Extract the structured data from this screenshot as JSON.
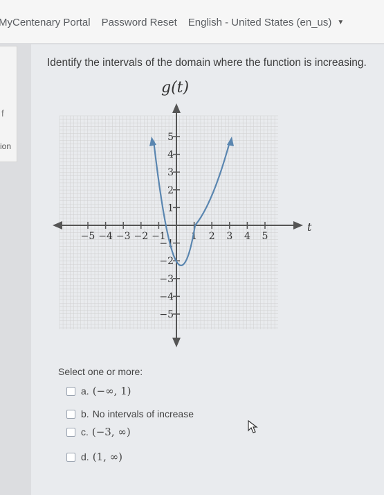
{
  "nav": {
    "items": [
      "MyCentenary Portal",
      "Password Reset",
      "English - United States (en_us)"
    ]
  },
  "sidebar": {
    "fragment_top": "f",
    "fragment_mid": "ion"
  },
  "question": {
    "text": "Identify the intervals of the domain where the function is increasing."
  },
  "graph": {
    "title": "g(t)",
    "axis_variable": "t",
    "x_ticks": [
      "−5",
      "−4",
      "−3",
      "−2",
      "−1",
      "1",
      "2",
      "3",
      "4",
      "5"
    ],
    "y_ticks_pos": [
      "5",
      "4",
      "3",
      "2",
      "1"
    ],
    "y_ticks_neg": [
      "−1",
      "−2",
      "−3",
      "−4",
      "−5"
    ]
  },
  "answers": {
    "prompt": "Select one or more:",
    "options": [
      {
        "letter": "a.",
        "text": "(−∞, 1)"
      },
      {
        "letter": "b.",
        "text": "No intervals of increase"
      },
      {
        "letter": "c.",
        "text": "(−3, ∞)"
      },
      {
        "letter": "d.",
        "text": "(1, ∞)"
      }
    ]
  },
  "colors": {
    "curve": "#5a86b0",
    "axis": "#555555",
    "grid": "#cfcfcf"
  }
}
